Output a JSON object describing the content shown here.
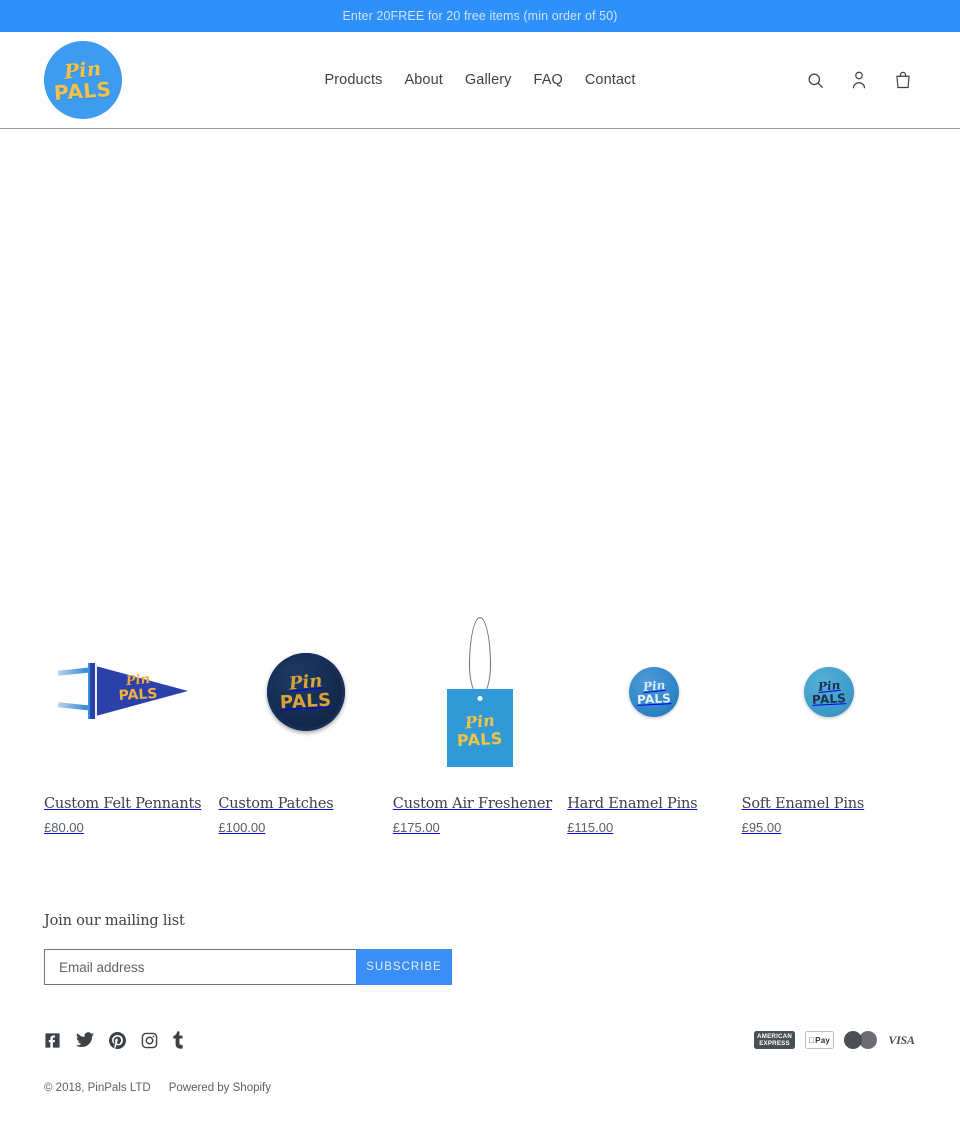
{
  "announcement": {
    "text": "Enter 20FREE for 20 free items (min order of 50)",
    "background": "#2e90fa",
    "text_color": "#cfe4fb"
  },
  "header": {
    "logo": {
      "line1": "Pin",
      "line2": "PALS",
      "circle_color": "#3d9bf0",
      "text_color": "#f6c245"
    },
    "nav": [
      {
        "label": "Products"
      },
      {
        "label": "About"
      },
      {
        "label": "Gallery"
      },
      {
        "label": "FAQ"
      },
      {
        "label": "Contact"
      }
    ],
    "icons": [
      {
        "name": "search-icon",
        "label": "Search"
      },
      {
        "name": "account-icon",
        "label": "Log in"
      },
      {
        "name": "cart-icon",
        "label": "Cart"
      }
    ]
  },
  "products": [
    {
      "title": "Custom Felt Pennants",
      "price": "£80.00",
      "art": "pennant",
      "art_text": {
        "line1": "Pin",
        "line2": "PALS"
      }
    },
    {
      "title": "Custom Patches",
      "price": "£100.00",
      "art": "patch",
      "art_text": {
        "line1": "Pin",
        "line2": "PALS"
      }
    },
    {
      "title": "Custom Air Freshener",
      "price": "£175.00",
      "art": "freshener",
      "art_text": {
        "line1": "Pin",
        "line2": "PALS"
      }
    },
    {
      "title": "Hard Enamel Pins",
      "price": "£115.00",
      "art": "pin-hard",
      "art_text": {
        "line1": "Pin",
        "line2": "PALS"
      }
    },
    {
      "title": "Soft Enamel Pins",
      "price": "£95.00",
      "art": "pin-soft",
      "art_text": {
        "line1": "Pin",
        "line2": "PALS"
      }
    }
  ],
  "newsletter": {
    "heading": "Join our mailing list",
    "input_placeholder": "Email address",
    "input_value": "",
    "submit_label": "SUBSCRIBE",
    "submit_color": "#3b8ef5"
  },
  "footer": {
    "social": [
      {
        "name": "facebook-icon",
        "label": "Facebook"
      },
      {
        "name": "twitter-icon",
        "label": "Twitter"
      },
      {
        "name": "pinterest-icon",
        "label": "Pinterest"
      },
      {
        "name": "instagram-icon",
        "label": "Instagram"
      },
      {
        "name": "tumblr-icon",
        "label": "Tumblr"
      }
    ],
    "payments": [
      {
        "name": "amex-icon",
        "line1": "AMERICAN",
        "line2": "EXPRESS"
      },
      {
        "name": "apple-pay-icon",
        "label": "Pay"
      },
      {
        "name": "mastercard-icon",
        "label": "MasterCard"
      },
      {
        "name": "visa-icon",
        "label": "VISA"
      }
    ],
    "copyright": "© 2018, PinPals LTD",
    "powered_by": "Powered by Shopify"
  }
}
